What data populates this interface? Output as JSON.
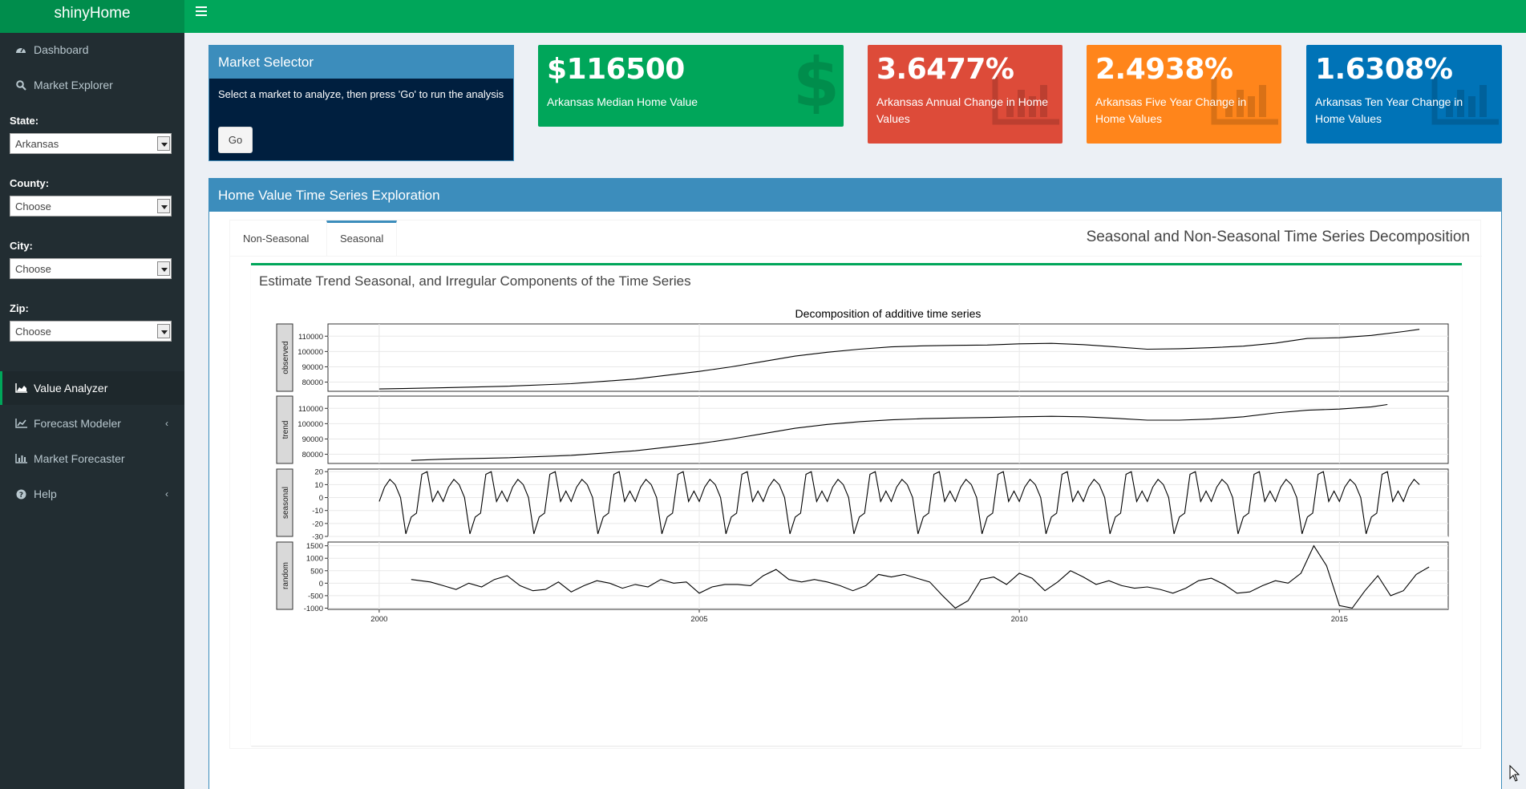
{
  "app": {
    "title": "shinyHome"
  },
  "sidebar": {
    "items": [
      {
        "label": "Dashboard",
        "icon": "dashboard-icon"
      },
      {
        "label": "Market Explorer",
        "icon": "search-icon"
      },
      {
        "label": "Value Analyzer",
        "icon": "area-chart-icon",
        "active": true
      },
      {
        "label": "Forecast Modeler",
        "icon": "line-chart-icon",
        "has_submenu": true
      },
      {
        "label": "Market Forecaster",
        "icon": "bar-chart-icon"
      },
      {
        "label": "Help",
        "icon": "question-circle-icon",
        "has_submenu": true
      }
    ],
    "filters": {
      "state": {
        "label": "State:",
        "value": "Arkansas"
      },
      "county": {
        "label": "County:",
        "value": "Choose"
      },
      "city": {
        "label": "City:",
        "value": "Choose"
      },
      "zip": {
        "label": "Zip:",
        "value": "Choose"
      }
    }
  },
  "market_selector": {
    "title": "Market Selector",
    "instructions": "Select a market to analyze, then press 'Go' to run the analysis",
    "go_label": "Go"
  },
  "value_boxes": [
    {
      "value": "$116500",
      "subtitle": "Arkansas Median Home Value",
      "color": "#00a65a",
      "icon": "dollar-icon"
    },
    {
      "value": "3.6477%",
      "subtitle": "Arkansas Annual Change in Home Values",
      "color": "#dd4b39",
      "icon": "bar-chart-icon"
    },
    {
      "value": "2.4938%",
      "subtitle": "Arkansas Five Year Change in Home Values",
      "color": "#ff851b",
      "icon": "bar-chart-icon"
    },
    {
      "value": "1.6308%",
      "subtitle": "Arkansas Ten Year Change in Home Values",
      "color": "#0073b7",
      "icon": "bar-chart-icon"
    }
  ],
  "exploration": {
    "title": "Home Value Time Series Exploration",
    "tabs": [
      {
        "label": "Non-Seasonal",
        "active": false
      },
      {
        "label": "Seasonal",
        "active": true
      }
    ],
    "tab_title": "Seasonal and Non-Seasonal Time Series Decomposition",
    "inner_title": "Estimate Trend Seasonal, and Irregular Components of the Time Series"
  },
  "chart_data": {
    "type": "line",
    "title": "Decomposition of additive time series",
    "x_ticks": [
      2000,
      2005,
      2010,
      2015
    ],
    "xlim": [
      1999.2,
      2016.7
    ],
    "panels": [
      {
        "name": "observed",
        "ylim": [
          74000,
          118000
        ],
        "y_ticks": [
          80000,
          90000,
          100000,
          110000
        ],
        "points": [
          [
            2000.0,
            75500
          ],
          [
            2001.0,
            76300
          ],
          [
            2002.0,
            77300
          ],
          [
            2003.0,
            79000
          ],
          [
            2004.0,
            82000
          ],
          [
            2005.0,
            87000
          ],
          [
            2005.5,
            90000
          ],
          [
            2006.0,
            93500
          ],
          [
            2006.5,
            97000
          ],
          [
            2007.0,
            99500
          ],
          [
            2007.5,
            101500
          ],
          [
            2008.0,
            103000
          ],
          [
            2008.5,
            103700
          ],
          [
            2009.0,
            104000
          ],
          [
            2009.5,
            104200
          ],
          [
            2010.0,
            105000
          ],
          [
            2010.5,
            105300
          ],
          [
            2011.0,
            104500
          ],
          [
            2011.5,
            103000
          ],
          [
            2012.0,
            101500
          ],
          [
            2012.5,
            101800
          ],
          [
            2013.0,
            102500
          ],
          [
            2013.5,
            103500
          ],
          [
            2014.0,
            105500
          ],
          [
            2014.5,
            108500
          ],
          [
            2015.0,
            109000
          ],
          [
            2015.5,
            110500
          ],
          [
            2016.0,
            113000
          ],
          [
            2016.25,
            114500
          ]
        ]
      },
      {
        "name": "trend",
        "ylim": [
          74000,
          118000
        ],
        "y_ticks": [
          80000,
          90000,
          100000,
          110000
        ],
        "points": [
          [
            2000.5,
            76000
          ],
          [
            2001.0,
            76800
          ],
          [
            2002.0,
            77700
          ],
          [
            2003.0,
            79300
          ],
          [
            2004.0,
            82300
          ],
          [
            2005.0,
            87000
          ],
          [
            2005.5,
            90000
          ],
          [
            2006.0,
            93500
          ],
          [
            2006.5,
            97000
          ],
          [
            2007.0,
            99500
          ],
          [
            2007.5,
            101300
          ],
          [
            2008.0,
            102500
          ],
          [
            2008.5,
            103300
          ],
          [
            2009.0,
            103700
          ],
          [
            2009.5,
            104000
          ],
          [
            2010.0,
            104500
          ],
          [
            2010.5,
            104800
          ],
          [
            2011.0,
            104500
          ],
          [
            2011.5,
            103500
          ],
          [
            2012.0,
            102300
          ],
          [
            2012.5,
            102300
          ],
          [
            2013.0,
            103000
          ],
          [
            2013.5,
            104500
          ],
          [
            2014.0,
            107000
          ],
          [
            2014.5,
            108800
          ],
          [
            2015.0,
            109500
          ],
          [
            2015.5,
            111000
          ],
          [
            2015.75,
            112500
          ]
        ]
      },
      {
        "name": "seasonal",
        "ylim": [
          -30,
          22
        ],
        "y_ticks": [
          -30,
          -20,
          -10,
          0,
          10,
          20
        ],
        "cycle": [
          -3,
          8,
          14,
          10,
          0,
          -28,
          -15,
          -12,
          18,
          20,
          -3,
          5
        ],
        "start": 2000.0,
        "end": 2016.25
      },
      {
        "name": "random",
        "ylim": [
          -1050,
          1650
        ],
        "y_ticks": [
          -1000,
          -500,
          0,
          500,
          1000,
          1500
        ],
        "points": [
          [
            2000.5,
            150
          ],
          [
            2000.8,
            50
          ],
          [
            2001.0,
            -100
          ],
          [
            2001.2,
            -250
          ],
          [
            2001.4,
            0
          ],
          [
            2001.6,
            -150
          ],
          [
            2001.8,
            150
          ],
          [
            2002.0,
            300
          ],
          [
            2002.2,
            -100
          ],
          [
            2002.4,
            -300
          ],
          [
            2002.6,
            -250
          ],
          [
            2002.8,
            50
          ],
          [
            2003.0,
            -350
          ],
          [
            2003.2,
            -100
          ],
          [
            2003.4,
            100
          ],
          [
            2003.6,
            0
          ],
          [
            2003.8,
            -200
          ],
          [
            2004.0,
            -50
          ],
          [
            2004.2,
            -150
          ],
          [
            2004.4,
            150
          ],
          [
            2004.6,
            0
          ],
          [
            2004.8,
            50
          ],
          [
            2005.0,
            -400
          ],
          [
            2005.2,
            -150
          ],
          [
            2005.4,
            -50
          ],
          [
            2005.6,
            -50
          ],
          [
            2005.8,
            -100
          ],
          [
            2006.0,
            300
          ],
          [
            2006.2,
            550
          ],
          [
            2006.4,
            150
          ],
          [
            2006.6,
            50
          ],
          [
            2006.8,
            150
          ],
          [
            2007.0,
            50
          ],
          [
            2007.2,
            -100
          ],
          [
            2007.4,
            -300
          ],
          [
            2007.6,
            -100
          ],
          [
            2007.8,
            350
          ],
          [
            2008.0,
            250
          ],
          [
            2008.2,
            350
          ],
          [
            2008.4,
            200
          ],
          [
            2008.6,
            50
          ],
          [
            2008.8,
            -500
          ],
          [
            2009.0,
            -1000
          ],
          [
            2009.2,
            -700
          ],
          [
            2009.4,
            150
          ],
          [
            2009.6,
            250
          ],
          [
            2009.8,
            -50
          ],
          [
            2010.0,
            400
          ],
          [
            2010.2,
            200
          ],
          [
            2010.4,
            -300
          ],
          [
            2010.6,
            50
          ],
          [
            2010.8,
            500
          ],
          [
            2011.0,
            250
          ],
          [
            2011.2,
            -50
          ],
          [
            2011.4,
            100
          ],
          [
            2011.6,
            -100
          ],
          [
            2011.8,
            -200
          ],
          [
            2012.0,
            -150
          ],
          [
            2012.2,
            -250
          ],
          [
            2012.4,
            -400
          ],
          [
            2012.6,
            -200
          ],
          [
            2012.8,
            100
          ],
          [
            2013.0,
            200
          ],
          [
            2013.2,
            -50
          ],
          [
            2013.4,
            -400
          ],
          [
            2013.6,
            -350
          ],
          [
            2013.8,
            -100
          ],
          [
            2014.0,
            100
          ],
          [
            2014.2,
            0
          ],
          [
            2014.4,
            400
          ],
          [
            2014.6,
            1500
          ],
          [
            2014.8,
            700
          ],
          [
            2015.0,
            -900
          ],
          [
            2015.2,
            -1000
          ],
          [
            2015.4,
            -300
          ],
          [
            2015.6,
            300
          ],
          [
            2015.8,
            -500
          ],
          [
            2016.0,
            -300
          ],
          [
            2016.2,
            350
          ],
          [
            2016.4,
            650
          ]
        ]
      }
    ]
  }
}
